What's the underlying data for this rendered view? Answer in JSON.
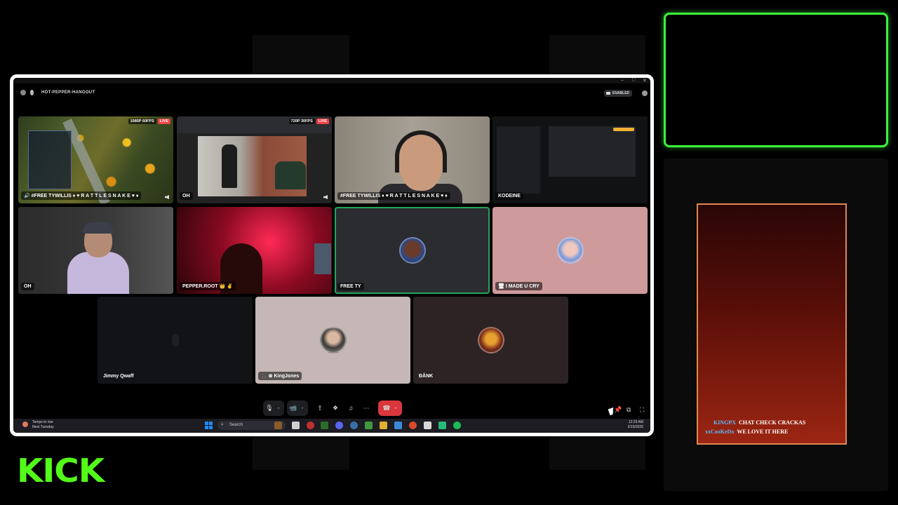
{
  "stream": {
    "kick_logo": "KICK",
    "chat": [
      {
        "user": "KINGPX",
        "message": "CHAT CHECK CRACKAS"
      },
      {
        "user": "xxCooKeDx",
        "message": "WE LOVE IT HERE"
      }
    ],
    "accent_color": "#53fc18"
  },
  "window": {
    "controls": [
      "–",
      "□",
      "✕"
    ],
    "channel_name": "HOT-PEPPER-HANGOUT",
    "enabled_label": "ENABLED"
  },
  "tiles": [
    {
      "label": "🔊 #FREE TYWILLIS ♦ ♥ R A T T L E S N A K E ♥ ♦",
      "resolution": "1080P 60FPS",
      "live": "LIVE"
    },
    {
      "label": "OH",
      "resolution": "720P 30FPS",
      "live": "LIVE"
    },
    {
      "label": "#FREE TYWILLIS ♦ ♥ R A T T L E S N A K E ♥ ♦"
    },
    {
      "label": "KODEINE"
    },
    {
      "label": "OH"
    },
    {
      "label": "PEPPER.ROOT 👑 ✌"
    },
    {
      "label": "FREE TY"
    },
    {
      "label": "🖥 I MADE U CRY"
    },
    {
      "label": "Jimmy Qwaff"
    },
    {
      "label": "🎧 ⊗ KingJones"
    },
    {
      "label": "ĐÅNK"
    }
  ],
  "controls": {
    "mic": "🎙",
    "camera": "📹",
    "screen_share": "⇪",
    "activities": "❖",
    "soundboard": "♫",
    "more": "⋯",
    "hangup": "☎",
    "caret": "⌄",
    "pin": "📌",
    "popout": "⧉",
    "fullscreen": "⛶"
  },
  "taskbar": {
    "weather_line1": "Temps to rise",
    "weather_line2": "Next Tuesday",
    "search_label": "Search",
    "time": "12:29 AM",
    "date": "2/15/2026"
  }
}
